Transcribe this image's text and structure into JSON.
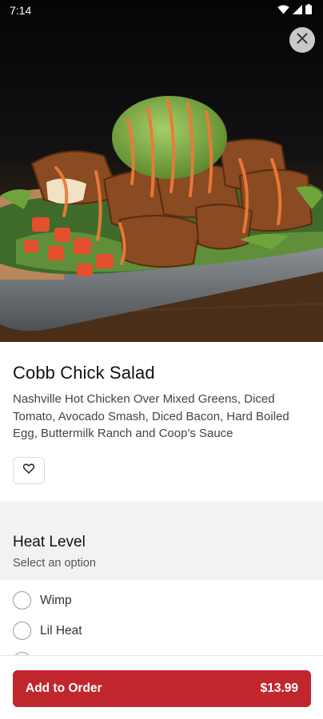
{
  "status_bar": {
    "time": "7:14"
  },
  "item": {
    "title": "Cobb Chick Salad",
    "description": "Nashville Hot Chicken Over Mixed Greens, Diced Tomato, Avocado Smash, Diced Bacon,  Hard Boiled Egg, Buttermilk Ranch and Coop's Sauce"
  },
  "icons": {
    "close": "close-icon",
    "favorite": "heart-icon",
    "wifi": "wifi-icon",
    "signal": "signal-icon",
    "battery": "battery-icon"
  },
  "heat_level": {
    "title": "Heat Level",
    "subtitle": "Select an option",
    "options": [
      {
        "label": "Wimp"
      },
      {
        "label": "Lil Heat"
      }
    ]
  },
  "order_button": {
    "label": "Add to Order",
    "price": "$13.99"
  },
  "colors": {
    "accent": "#c0272d",
    "section_bg": "#f2f2f2"
  }
}
